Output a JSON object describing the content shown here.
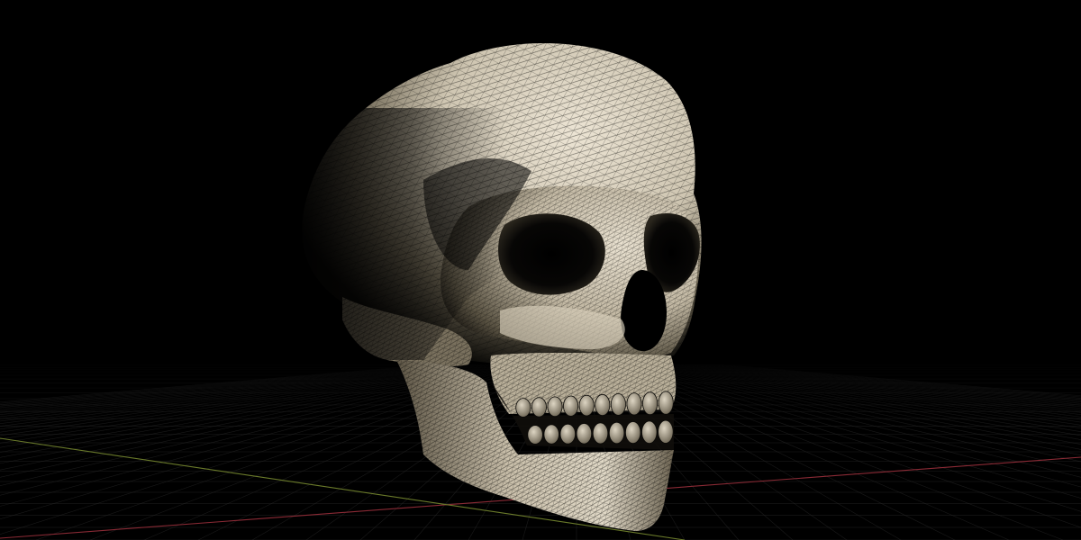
{
  "viewport": {
    "background": "#000000",
    "mode": "wireframe-on-shaded",
    "object": "skull-mesh"
  },
  "colors": {
    "bone_light": "#e7dfcf",
    "bone_mid": "#b8ae99",
    "bone_dark": "#4a4436",
    "wire": "#0b0a08",
    "grid": "#2b2b2b",
    "axis_x": "#8a2a35",
    "axis_z": "#6a7a2a"
  }
}
